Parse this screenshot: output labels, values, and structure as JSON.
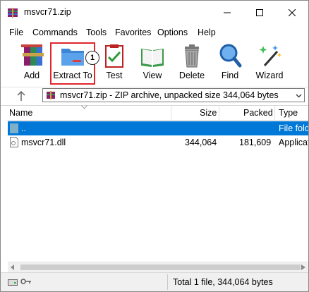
{
  "window": {
    "title": "msvcr71.zip"
  },
  "menu": [
    "File",
    "Commands",
    "Tools",
    "Favorites",
    "Options",
    "Help"
  ],
  "toolbar": {
    "tools": [
      "Add",
      "Extract To",
      "Test",
      "View",
      "Delete",
      "Find",
      "Wizard"
    ],
    "step_badge": "1"
  },
  "address": {
    "text": "msvcr71.zip - ZIP archive, unpacked size 344,064 bytes"
  },
  "columns": {
    "name": "Name",
    "size": "Size",
    "packed": "Packed",
    "type": "Type"
  },
  "rows": [
    {
      "name": "..",
      "size": "",
      "packed": "",
      "type": "File folder"
    },
    {
      "name": "msvcr71.dll",
      "size": "344,064",
      "packed": "181,609",
      "type": "Application extension"
    }
  ],
  "status": {
    "text": "Total 1 file, 344,064 bytes"
  },
  "colors": {
    "selection": "#0078d7",
    "highlight": "#e0262c"
  }
}
